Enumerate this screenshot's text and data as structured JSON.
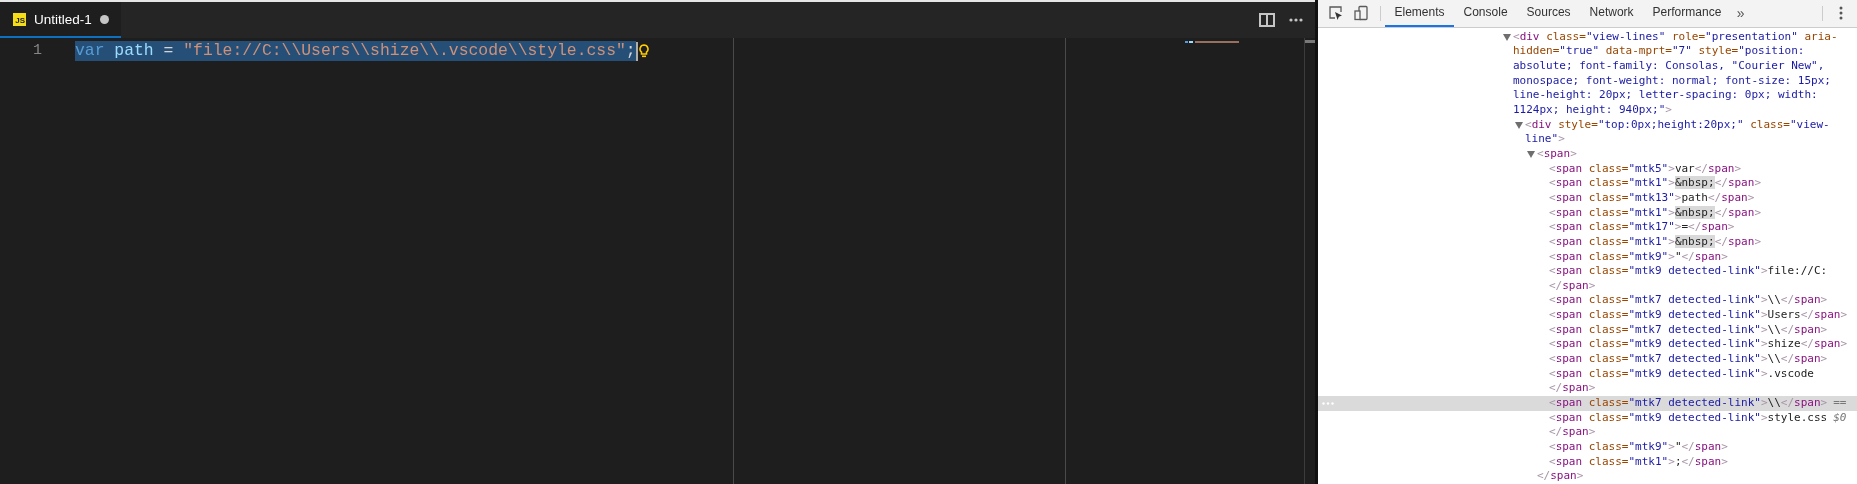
{
  "editor": {
    "tabs": [
      {
        "label": "Untitled-1",
        "badge": "JS",
        "dirty": true,
        "selected": true
      }
    ],
    "lines": [
      {
        "number": "1",
        "selected": true,
        "tokens": [
          {
            "text": "var ",
            "kind": "keyword"
          },
          {
            "text": "path",
            "kind": "variable"
          },
          {
            "text": " = ",
            "kind": "operator"
          },
          {
            "text": "\"file://C:\\\\Users\\\\shize\\\\.vscode\\\\style.css\"",
            "kind": "string"
          },
          {
            "text": ";",
            "kind": "punctuation"
          }
        ]
      }
    ]
  },
  "devtools": {
    "tabs": [
      {
        "label": "Elements",
        "selected": true
      },
      {
        "label": "Console",
        "selected": false
      },
      {
        "label": "Sources",
        "selected": false
      },
      {
        "label": "Network",
        "selected": false
      },
      {
        "label": "Performance",
        "selected": false
      }
    ],
    "overflow": "»",
    "dom_tree": [
      {
        "expanded": true,
        "selected": false,
        "lines": [
          "<div class=\"view-lines\" role=\"presentation\" aria-",
          "hidden=\"true\" data-mprt=\"7\" style=\"position:",
          "absolute; font-family: Consolas, \"Courier New\",",
          "monospace; font-weight: normal; font-size: 15px;",
          "line-height: 20px; letter-spacing: 0px; width:",
          "1124px; height: 940px;\">"
        ],
        "children": [
          {
            "expanded": true,
            "selected": false,
            "lines": [
              "<div style=\"top:0px;height:20px;\" class=\"view-",
              "line\">"
            ],
            "children": [
              {
                "expanded": true,
                "selected": false,
                "lines": [
                  "<span>"
                ],
                "closing": "</span>",
                "children": [
                  {
                    "selected": false,
                    "lines": [
                      "<span class=\"mtk5\">var</span>"
                    ]
                  },
                  {
                    "selected": false,
                    "lines": [
                      "<span class=\"mtk1\">&nbsp;</span>"
                    ]
                  },
                  {
                    "selected": false,
                    "lines": [
                      "<span class=\"mtk13\">path</span>"
                    ]
                  },
                  {
                    "selected": false,
                    "lines": [
                      "<span class=\"mtk1\">&nbsp;</span>"
                    ]
                  },
                  {
                    "selected": false,
                    "lines": [
                      "<span class=\"mtk17\">=</span>"
                    ]
                  },
                  {
                    "selected": false,
                    "lines": [
                      "<span class=\"mtk1\">&nbsp;</span>"
                    ]
                  },
                  {
                    "selected": false,
                    "lines": [
                      "<span class=\"mtk9\">\"</span>"
                    ]
                  },
                  {
                    "selected": false,
                    "lines": [
                      "<span class=\"mtk9 detected-link\">file://C:",
                      "</span>"
                    ]
                  },
                  {
                    "selected": false,
                    "lines": [
                      "<span class=\"mtk7 detected-link\">\\\\</span>"
                    ]
                  },
                  {
                    "selected": false,
                    "lines": [
                      "<span class=\"mtk9 detected-link\">Users</span>"
                    ]
                  },
                  {
                    "selected": false,
                    "lines": [
                      "<span class=\"mtk7 detected-link\">\\\\</span>"
                    ]
                  },
                  {
                    "selected": false,
                    "lines": [
                      "<span class=\"mtk9 detected-link\">shize</span>"
                    ]
                  },
                  {
                    "selected": false,
                    "lines": [
                      "<span class=\"mtk7 detected-link\">\\\\</span>"
                    ]
                  },
                  {
                    "selected": false,
                    "lines": [
                      "<span class=\"mtk9 detected-link\">.vscode",
                      "</span>"
                    ]
                  },
                  {
                    "selected": true,
                    "marker": "==",
                    "lines": [
                      "<span class=\"mtk7 detected-link\">\\\\</span>"
                    ]
                  },
                  {
                    "selected": false,
                    "marker": "$0",
                    "lines": [
                      "<span class=\"mtk9 detected-link\">style.css",
                      "</span>"
                    ]
                  },
                  {
                    "selected": false,
                    "lines": [
                      "<span class=\"mtk9\">\"</span>"
                    ]
                  },
                  {
                    "selected": false,
                    "lines": [
                      "<span class=\"mtk1\">;</span>"
                    ]
                  }
                ]
              }
            ]
          }
        ]
      }
    ]
  }
}
